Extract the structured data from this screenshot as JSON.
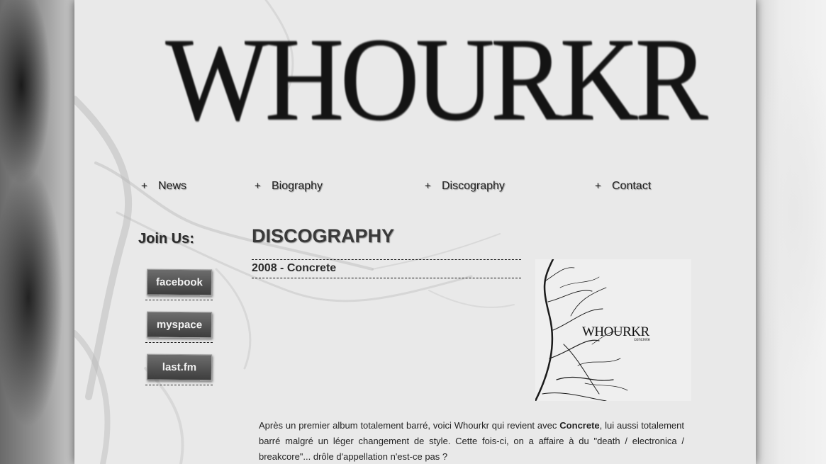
{
  "site": {
    "logo_text": "WHOURKR"
  },
  "nav": {
    "plus_symbol": "+",
    "items": [
      {
        "label": "News"
      },
      {
        "label": "Biography"
      },
      {
        "label": "Discography"
      },
      {
        "label": "Contact"
      }
    ]
  },
  "sidebar": {
    "join_title": "Join Us:",
    "social": [
      {
        "label": "facebook",
        "icon": "facebook-badge"
      },
      {
        "label": "myspace",
        "icon": "myspace-badge"
      },
      {
        "label": "last.fm",
        "icon": "lastfm-badge"
      }
    ]
  },
  "main": {
    "section_title": "DISCOGRAPHY",
    "album_heading": "2008 - Concrete",
    "cover": {
      "title": "WHOURKR",
      "subtitle": "concrete"
    },
    "description": {
      "part1": "Après un premier album totalement barré, voici Whourkr qui revient avec ",
      "bold": "Concrete",
      "part2": ", lui aussi totalement barré malgré un léger changement de style. Cette fois-ci, on a affaire à du \"death / electronica / breakcore\"... drôle d'appellation n'est-ce pas ?"
    }
  }
}
